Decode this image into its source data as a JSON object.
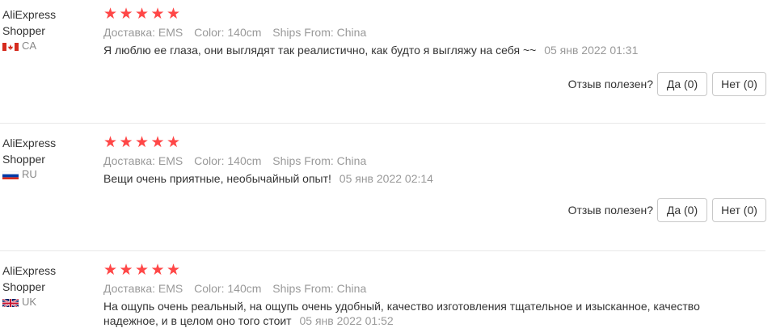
{
  "reviews": [
    {
      "user_line1": "AliExpress",
      "user_line2": "Shopper",
      "country": "CA",
      "rating": 5,
      "delivery": "Доставка: EMS",
      "color": "Color: 140cm",
      "ships_from": "Ships From: China",
      "text": "Я люблю ее глаза, они выглядят так реалистично, как будто я выгляжу на себя ~~",
      "date": "05 янв 2022 01:31",
      "helpful_question": "Отзыв полезен?",
      "yes_label": "Да (0)",
      "no_label": "Нет (0)"
    },
    {
      "user_line1": "AliExpress",
      "user_line2": "Shopper",
      "country": "RU",
      "rating": 5,
      "delivery": "Доставка: EMS",
      "color": "Color: 140cm",
      "ships_from": "Ships From: China",
      "text": "Вещи очень приятные, необычайный опыт!",
      "date": "05 янв 2022 02:14",
      "helpful_question": "Отзыв полезен?",
      "yes_label": "Да (0)",
      "no_label": "Нет (0)"
    },
    {
      "user_line1": "AliExpress",
      "user_line2": "Shopper",
      "country": "UK",
      "rating": 5,
      "delivery": "Доставка: EMS",
      "color": "Color: 140cm",
      "ships_from": "Ships From: China",
      "text": "На ощупь очень реальный, на ощупь очень удобный, качество изготовления тщательное и изысканное, качество надежное, и в целом оно того стоит",
      "date": "05 янв 2022 01:52"
    }
  ],
  "colors": {
    "star": "#ff4747",
    "meta": "#999999",
    "text": "#333333"
  },
  "icons": {
    "star": "star-icon",
    "flag_ca": "flag-ca-icon",
    "flag_ru": "flag-ru-icon",
    "flag_uk": "flag-uk-icon"
  }
}
